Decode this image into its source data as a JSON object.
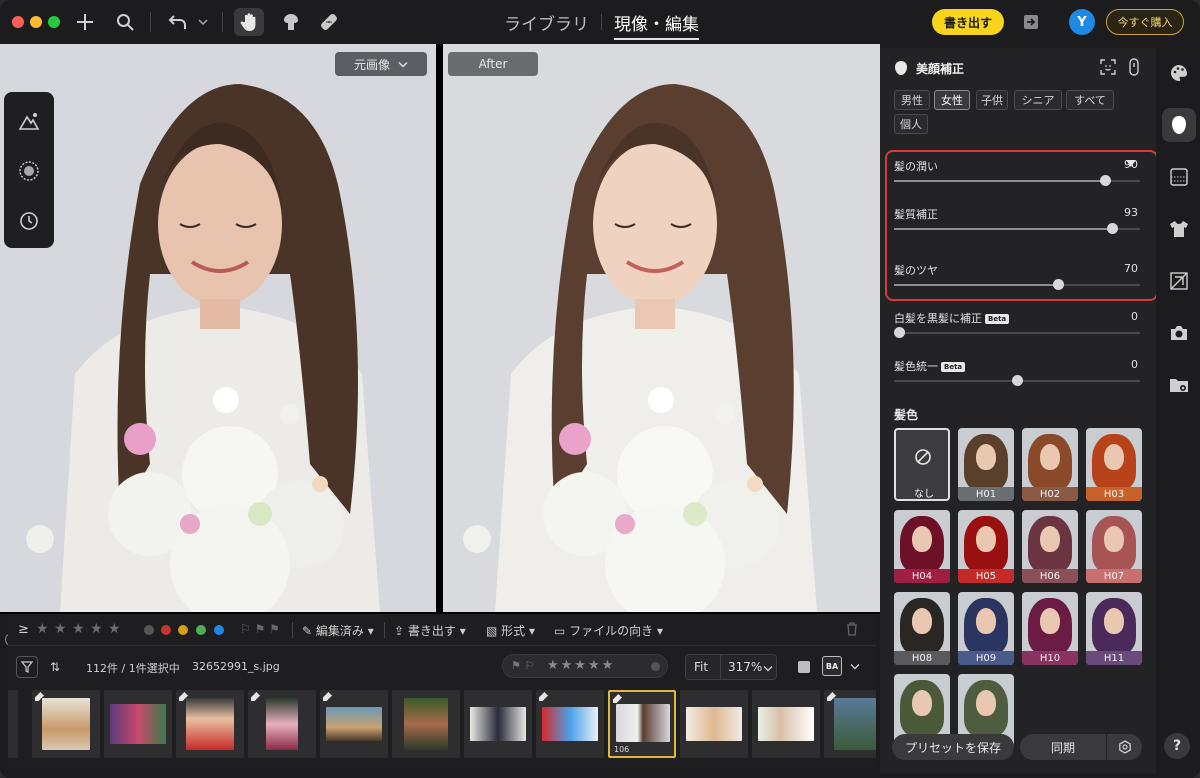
{
  "titlebar": {
    "nav_library": "ライブラリ",
    "nav_develop": "現像・編集",
    "export_label": "書き出す",
    "avatar_letter": "Y",
    "buy_label": "今すぐ購入"
  },
  "canvas": {
    "original_label": "元画像",
    "after_label": "After"
  },
  "filmstrip": {
    "edited_label": "編集済み",
    "export_label": "書き出す",
    "format_label": "形式",
    "orientation_label": "ファイルの向き",
    "count_label": "112件 / 1件選択中",
    "filename": "32652991_s.jpg",
    "fit_label": "Fit",
    "zoom_label": "317%",
    "ba_label": "BA",
    "selected_number": "106",
    "color_labels": [
      "#c0392b",
      "#d4a017",
      "#4caf50",
      "#1e88e5"
    ]
  },
  "panel": {
    "title": "美顔補正",
    "groups": [
      "男性",
      "女性",
      "子供",
      "シニア",
      "すべて",
      "個人"
    ],
    "active_group": "女性",
    "sliders": [
      {
        "label": "髪の潤い",
        "value": 90,
        "beta": false
      },
      {
        "label": "髪質補正",
        "value": 93,
        "beta": false
      },
      {
        "label": "髪のツヤ",
        "value": 70,
        "beta": false
      },
      {
        "label": "白髪を黒髪に補正",
        "value": 0,
        "beta": true
      },
      {
        "label": "髪色統一",
        "value": 0,
        "beta": true
      }
    ],
    "beta_label": "Beta",
    "hair_color_heading": "髪色",
    "swatches": [
      {
        "label": "なし",
        "color": "#3c3c3e",
        "hair": "#3c3c3e",
        "bar": "#3c3c3e"
      },
      {
        "label": "H01",
        "color": "#6b6f74",
        "hair": "#5a3f2a",
        "bar": "#6b6f74"
      },
      {
        "label": "H02",
        "color": "#7a5a48",
        "hair": "#8a4a2a",
        "bar": "#8a5a44"
      },
      {
        "label": "H03",
        "color": "#c25a2a",
        "hair": "#b8431a",
        "bar": "#c8622a"
      },
      {
        "label": "H04",
        "color": "#7a1e3a",
        "hair": "#6e1028",
        "bar": "#a01e44"
      },
      {
        "label": "H05",
        "color": "#a81e1e",
        "hair": "#9a1010",
        "bar": "#c42a2a"
      },
      {
        "label": "H06",
        "color": "#7a4a52",
        "hair": "#6a3440",
        "bar": "#8a5058"
      },
      {
        "label": "H07",
        "color": "#b86a6a",
        "hair": "#a85454",
        "bar": "#c87070"
      },
      {
        "label": "H08",
        "color": "#4a4a4a",
        "hair": "#2a2624",
        "bar": "#5a5a5c"
      },
      {
        "label": "H09",
        "color": "#3a4a72",
        "hair": "#2a3560",
        "bar": "#4a5a8a"
      },
      {
        "label": "H10",
        "color": "#7a2a52",
        "hair": "#6a1c44",
        "bar": "#8a3262"
      },
      {
        "label": "H11",
        "color": "#5a3a6a",
        "hair": "#4a2a5a",
        "bar": "#6a4a7a"
      },
      {
        "label": "",
        "color": "#5a6a4a",
        "hair": "#4a5a38",
        "bar": "#5a6a4a"
      },
      {
        "label": "",
        "color": "#5a6a4a",
        "hair": "#4e5c40",
        "bar": "#5a6a4a"
      }
    ],
    "save_preset_label": "プリセットを保存",
    "sync_label": "同期"
  },
  "help_label": "?"
}
